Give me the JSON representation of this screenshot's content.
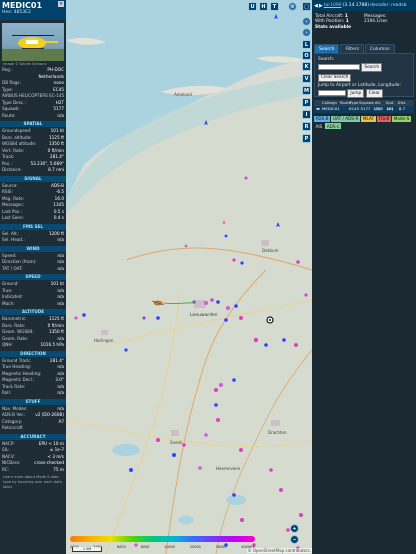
{
  "aircraft": {
    "callsign": "MEDIC01",
    "hex_label": "Hex: 4853E2",
    "image_credit": "Image © Daniel Schwarz"
  },
  "info_rows": [
    {
      "k": "Reg.:",
      "v": "PH-DOC"
    },
    {
      "k": "",
      "v": "Netherlands"
    },
    {
      "k": "DB flags:",
      "v": "none"
    },
    {
      "k": "Type:",
      "v": "EC45"
    },
    {
      "k": "AIRBUS HELICOPTERS EC-145",
      "v": ""
    },
    {
      "k": "Type Desc.:",
      "v": "H2T"
    },
    {
      "k": "Squawk:",
      "v": "5177"
    },
    {
      "k": "Route:",
      "v": "n/a"
    }
  ],
  "sections": [
    {
      "title": "SPATIAL",
      "rows": [
        {
          "k": "Groundspeed:",
          "v": "101 kt"
        },
        {
          "k": "Baro. altitude:",
          "v": "1125 ft"
        },
        {
          "k": "WGS84 altitude:",
          "v": "1350 ft"
        },
        {
          "k": "Vert. Rate:",
          "v": "0 ft/min"
        },
        {
          "k": "Track:",
          "v": "281.4°"
        },
        {
          "k": "Pos.:",
          "v": "53.230°, 5.669°"
        },
        {
          "k": "Distance:",
          "v": "8.7 nmi"
        }
      ]
    },
    {
      "title": "SIGNAL",
      "rows": [
        {
          "k": "Source:",
          "v": "ADS-B"
        },
        {
          "k": "RSSI:",
          "v": "-6.5"
        },
        {
          "k": "Msg. Rate:",
          "v": "16.0"
        },
        {
          "k": "Messages:",
          "v": "1345"
        },
        {
          "k": "Last Pos.:",
          "v": "0.5 s"
        },
        {
          "k": "Last Seen:",
          "v": "0.4 s"
        }
      ]
    },
    {
      "title": "FMS SEL",
      "rows": [
        {
          "k": "Sel. Alt.:",
          "v": "1200 ft"
        },
        {
          "k": "Sel. Head.:",
          "v": "n/a"
        }
      ]
    },
    {
      "title": "WIND",
      "rows": [
        {
          "k": "Speed:",
          "v": "n/a"
        },
        {
          "k": "Direction (from):",
          "v": "n/a"
        },
        {
          "k": "TAT / OAT:",
          "v": "n/a"
        }
      ]
    },
    {
      "title": "SPEED",
      "rows": [
        {
          "k": "Ground:",
          "v": "101 kt"
        },
        {
          "k": "True:",
          "v": "n/a"
        },
        {
          "k": "Indicated:",
          "v": "n/a"
        },
        {
          "k": "Mach:",
          "v": "n/a"
        }
      ]
    },
    {
      "title": "ALTITUDE",
      "rows": [
        {
          "k": "Barometric:",
          "v": "1125 ft"
        },
        {
          "k": "Baro. Rate:",
          "v": "0 ft/min"
        },
        {
          "k": "Geom. WGS84:",
          "v": "1350 ft"
        },
        {
          "k": "Geom. Rate:",
          "v": "n/a"
        },
        {
          "k": "QNH:",
          "v": "1016.5 hPa"
        }
      ]
    },
    {
      "title": "DIRECTION",
      "rows": [
        {
          "k": "Ground Track:",
          "v": "281.4°"
        },
        {
          "k": "True Heading:",
          "v": "n/a"
        },
        {
          "k": "Magnetic Heading:",
          "v": "n/a"
        },
        {
          "k": "Magnetic Decl.:",
          "v": "3.0°"
        },
        {
          "k": "Track Rate:",
          "v": "n/a"
        },
        {
          "k": "Roll:",
          "v": "n/a"
        }
      ]
    },
    {
      "title": "STUFF",
      "rows": [
        {
          "k": "Nav. Modes:",
          "v": "n/a"
        },
        {
          "k": "ADS-B Ver.:",
          "v": "v2 (DO-260B)"
        },
        {
          "k": "Category:",
          "v": "A7"
        },
        {
          "k": "Rotorcraft",
          "v": ""
        }
      ]
    },
    {
      "title": "ACCURACY",
      "rows": [
        {
          "k": "NACP:",
          "v": "EPU < 10 m"
        },
        {
          "k": "SIL:",
          "v": "≤ 1e-7"
        },
        {
          "k": "NACV:",
          "v": "< 3 m/s"
        },
        {
          "k": "NICBaro:",
          "v": "cross-checked"
        },
        {
          "k": "RC:",
          "v": "75 m"
        }
      ]
    }
  ],
  "footnote": "Learn more about Mode S data type by hovering over each data label.",
  "map": {
    "top_buttons": [
      "U",
      "H",
      "T"
    ],
    "side_buttons": [
      "L",
      "O",
      "K",
      "V",
      "M",
      "P",
      "I",
      "R",
      "P"
    ],
    "colorbar_labels": [
      "2000",
      "4000",
      "6000",
      "8000",
      "10000",
      "20000",
      "30000",
      "40000+"
    ],
    "scale_label": "1 SM",
    "attribution": "© OpenStreetMap contributors.",
    "place_labels": [
      "Ameland",
      "Dokkum",
      "Leeuwarden",
      "Harlingen",
      "Sneek",
      "Drachten",
      "Heerenveen"
    ]
  },
  "right_panel": {
    "link": "tar1090",
    "version": "(3.14.1788)",
    "decoder": "decoder: readsb",
    "total_label": "Total Aircraft:",
    "total_value": "1",
    "position_label": "With Position:",
    "position_value": "1",
    "stats_label": "Stats available",
    "messages_label": "Messages:",
    "messages_value": "2194.1/sec",
    "tabs": [
      "Search",
      "Filters",
      "Columns"
    ],
    "search_label": "Search:",
    "search_button": "Search",
    "clear_search_button": "Clear Search",
    "jump_label": "Jump to Airport or Latitude, Longitude:",
    "jump_button": "Jump",
    "clear_button": "Clear",
    "columns": [
      "",
      "Callsign",
      "Route",
      "Type",
      "Squawk",
      "Alt. (ft)",
      "Spd. (kt)",
      "Dist."
    ],
    "rows": [
      [
        "",
        "MEDIC01",
        "",
        "EC45",
        "5177",
        "1125",
        "101",
        "8.7"
      ]
    ],
    "badges": [
      {
        "label": "ADS-B",
        "color": "#5ab0e6"
      },
      {
        "label": "UAT / ADS-R",
        "color": "#7fc8a8"
      },
      {
        "label": "MLAT",
        "color": "#e7c04d"
      },
      {
        "label": "TIS-B",
        "color": "#e0605e"
      },
      {
        "label": "Mode-S",
        "color": "#8fd16a"
      },
      {
        "label": "AIS",
        "color": ""
      },
      {
        "label": "ADS-C",
        "color": "#7fd59a"
      }
    ]
  }
}
